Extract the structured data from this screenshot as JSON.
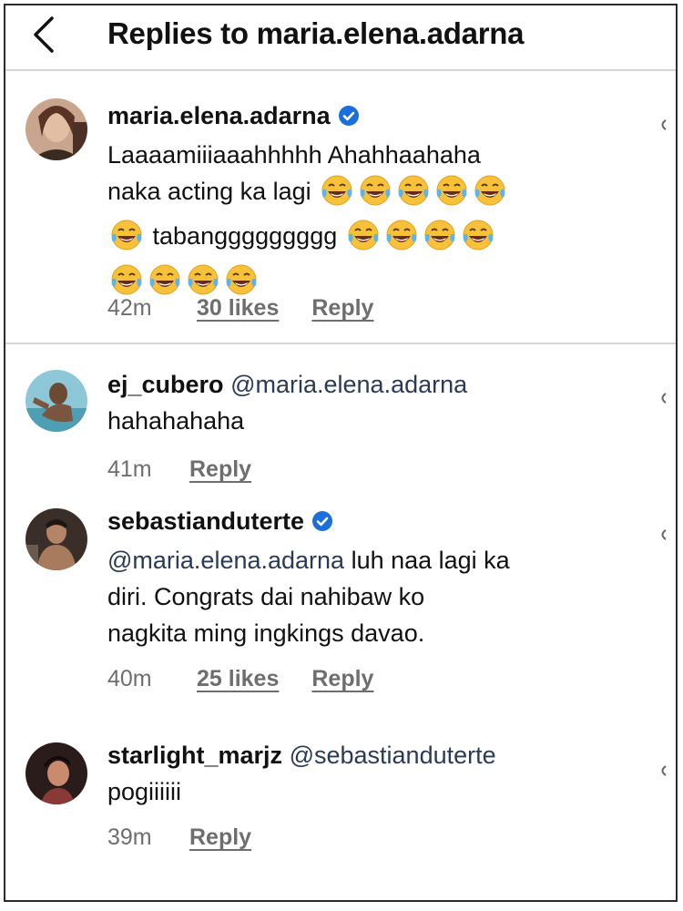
{
  "header": {
    "title": "Replies to maria.elena.adarna"
  },
  "colors": {
    "verified": "#1a6fd8",
    "text": "#111111",
    "meta": "#6e6e6e",
    "divider": "#d6d6d6"
  },
  "comments": [
    {
      "username": "maria.elena.adarna",
      "verified": true,
      "text_line1": "Laaaamiiiaaahhhhh Ahahhaahaha",
      "text_line2_prefix": "naka acting ka lagi",
      "text_line3_word": "tabanggggggggg",
      "emoji_name": "face-with-tears-of-joy-icon",
      "time": "42m",
      "likes": "30 likes",
      "reply": "Reply"
    },
    {
      "username": "ej_cubero",
      "verified": false,
      "mention": "@maria.elena.adarna",
      "text": "hahahahaha",
      "time": "41m",
      "reply": "Reply"
    },
    {
      "username": "sebastianduterte",
      "verified": true,
      "mention": "@maria.elena.adarna",
      "text_line1_rest": " luh naa lagi ka",
      "text_line2": "diri. Congrats dai nahibaw ko",
      "text_line3": "nagkita ming ingkings davao.",
      "time": "40m",
      "likes": "25 likes",
      "reply": "Reply"
    },
    {
      "username": "starlight_marjz",
      "verified": false,
      "mention": "@sebastianduterte",
      "text": "pogiiiiii",
      "time": "39m",
      "reply": "Reply"
    }
  ]
}
